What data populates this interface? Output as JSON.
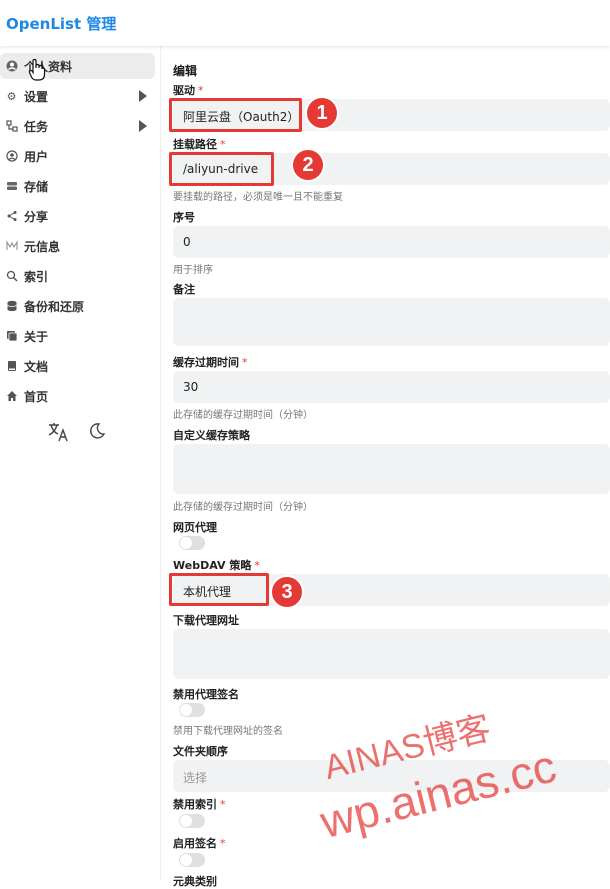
{
  "header": {
    "title": "OpenList 管理"
  },
  "sidebar": {
    "items": [
      {
        "label": "个人资料",
        "icon": "profile-icon",
        "active": true
      },
      {
        "label": "设置",
        "icon": "gear-icon",
        "has_submenu": true
      },
      {
        "label": "任务",
        "icon": "tasks-icon",
        "has_submenu": true
      },
      {
        "label": "用户",
        "icon": "user-icon"
      },
      {
        "label": "存储",
        "icon": "storage-icon"
      },
      {
        "label": "分享",
        "icon": "share-icon"
      },
      {
        "label": "元信息",
        "icon": "meta-icon"
      },
      {
        "label": "索引",
        "icon": "search-icon"
      },
      {
        "label": "备份和还原",
        "icon": "database-icon"
      },
      {
        "label": "关于",
        "icon": "about-icon"
      },
      {
        "label": "文档",
        "icon": "book-icon"
      },
      {
        "label": "首页",
        "icon": "home-icon"
      }
    ],
    "tools": {
      "language_icon": "translate-icon",
      "theme_icon": "moon-icon"
    }
  },
  "form": {
    "title": "编辑",
    "driver": {
      "label": "驱动",
      "value": "阿里云盘（Oauth2）"
    },
    "mount_path": {
      "label": "挂载路径",
      "value": "/aliyun-drive",
      "help": "要挂载的路径，必须是唯一且不能重复"
    },
    "order": {
      "label": "序号",
      "value": "0",
      "help": "用于排序"
    },
    "remark": {
      "label": "备注",
      "value": ""
    },
    "cache_expiration": {
      "label": "缓存过期时间",
      "value": "30",
      "help": "此存储的缓存过期时间（分钟）"
    },
    "custom_cache_policy": {
      "label": "自定义缓存策略",
      "value": "",
      "help": "此存储的缓存过期时间（分钟）"
    },
    "web_proxy": {
      "label": "网页代理",
      "enabled": false
    },
    "webdav_policy": {
      "label": "WebDAV 策略",
      "value": "本机代理"
    },
    "download_proxy_url": {
      "label": "下载代理网址",
      "value": ""
    },
    "disable_proxy_sign": {
      "label": "禁用代理签名",
      "enabled": false,
      "help": "禁用下载代理网址的签名"
    },
    "folder_order": {
      "label": "文件夹顺序",
      "placeholder": "选择"
    },
    "disable_index": {
      "label": "禁用索引",
      "enabled": false
    },
    "enable_sign": {
      "label": "启用签名",
      "enabled": false
    },
    "next_label": "元典类别"
  },
  "annotations": {
    "badge1": "1",
    "badge2": "2",
    "badge3": "3"
  },
  "watermark": {
    "line1": "AINAS博客",
    "line2": "wp.ainas.cc"
  },
  "colors": {
    "brand": "#1e88e5",
    "required": "#e53935",
    "annotation": "#e53935"
  }
}
